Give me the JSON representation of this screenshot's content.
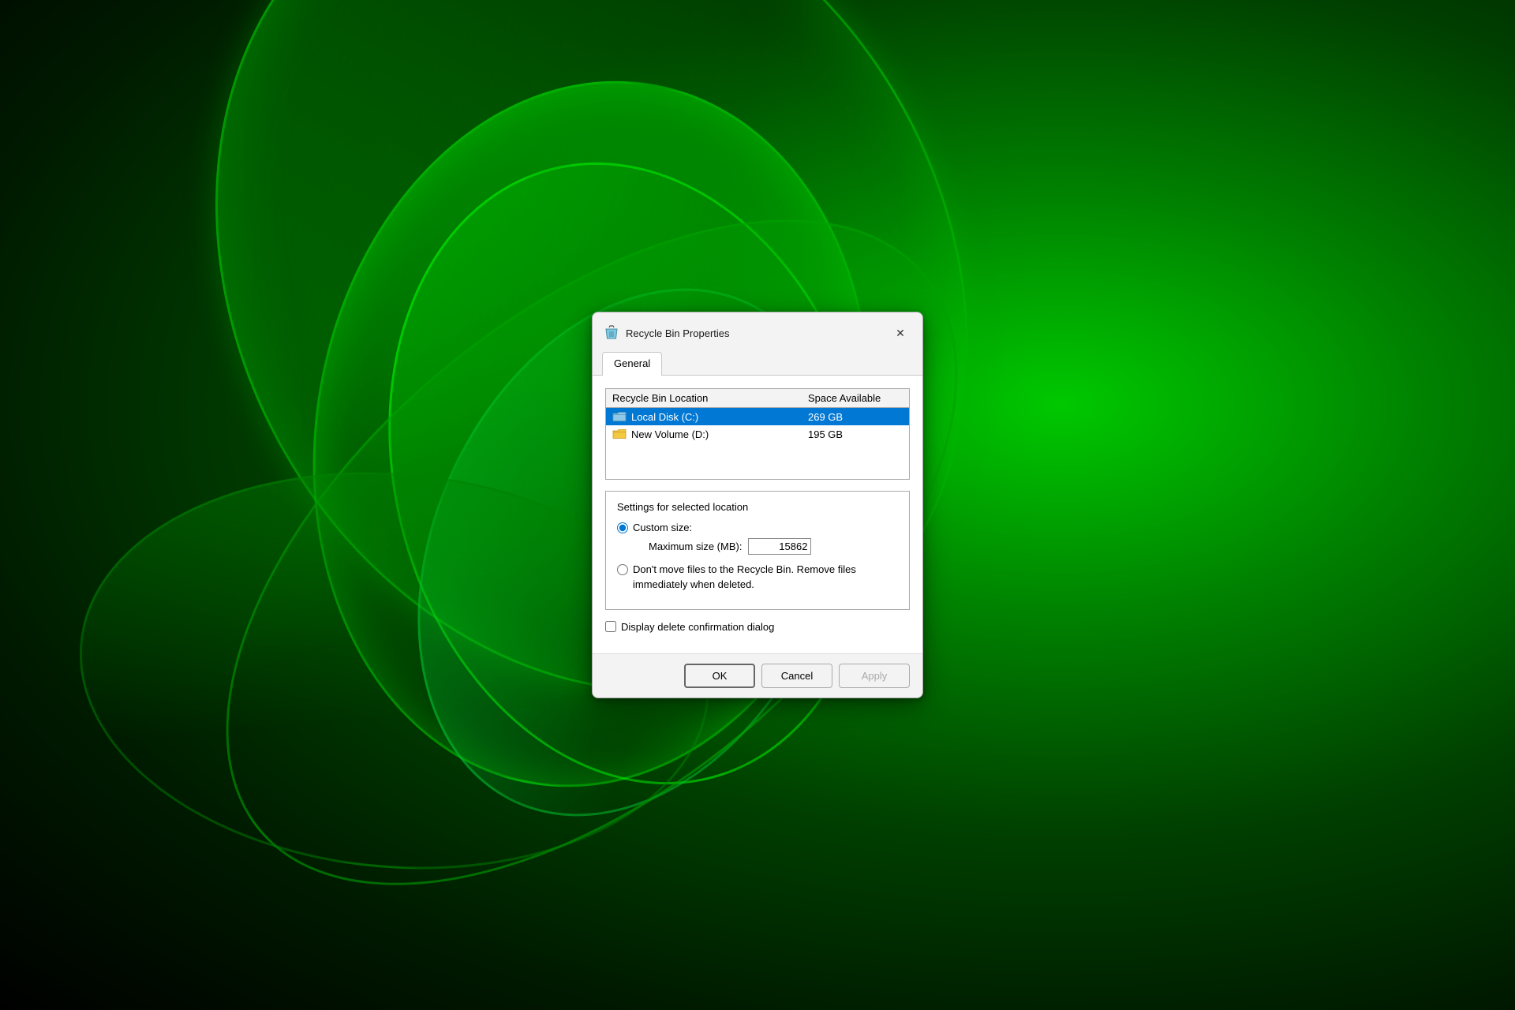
{
  "desktop": {
    "bg_color": "#001a00"
  },
  "dialog": {
    "title": "Recycle Bin Properties",
    "icon_alt": "recycle-bin",
    "tabs": [
      {
        "label": "General",
        "active": true
      }
    ],
    "drive_table": {
      "col_location": "Recycle Bin Location",
      "col_space": "Space Available",
      "rows": [
        {
          "name": "Local Disk (C:)",
          "space": "269 GB",
          "selected": true,
          "icon": "folder-c"
        },
        {
          "name": "New Volume (D:)",
          "space": "195 GB",
          "selected": false,
          "icon": "folder-d"
        }
      ]
    },
    "settings": {
      "title": "Settings for selected location",
      "options": [
        {
          "id": "custom-size",
          "label": "Custom size:",
          "checked": true,
          "has_size_field": true,
          "size_label": "Maximum size (MB):",
          "size_value": "15862"
        },
        {
          "id": "dont-move",
          "label": "Don't move files to the Recycle Bin. Remove files immediately when deleted.",
          "checked": false
        }
      ]
    },
    "checkbox": {
      "label": "Display delete confirmation dialog",
      "checked": false
    },
    "buttons": {
      "ok": "OK",
      "cancel": "Cancel",
      "apply": "Apply"
    }
  }
}
